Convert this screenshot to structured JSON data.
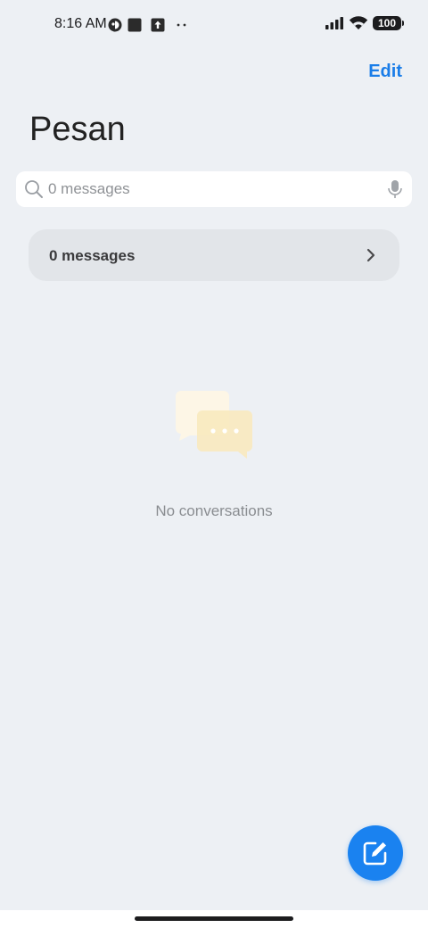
{
  "status_bar": {
    "time": "8:16 AM",
    "battery": "100",
    "left_icons": [
      "vpn-key-icon",
      "square-app-icon",
      "upload-icon",
      "more-dots-icon"
    ],
    "right_icons": [
      "cellular-signal-icon",
      "wifi-icon",
      "battery-icon"
    ]
  },
  "header": {
    "edit_label": "Edit",
    "title": "Pesan"
  },
  "search": {
    "placeholder": "0 messages",
    "value": ""
  },
  "messages_row": {
    "label": "0 messages"
  },
  "empty_state": {
    "text": "No conversations",
    "icon": "chat-bubbles-icon"
  },
  "colors": {
    "accent": "#1a7de8",
    "background": "#edf0f4",
    "fab": "#1a82f0"
  }
}
